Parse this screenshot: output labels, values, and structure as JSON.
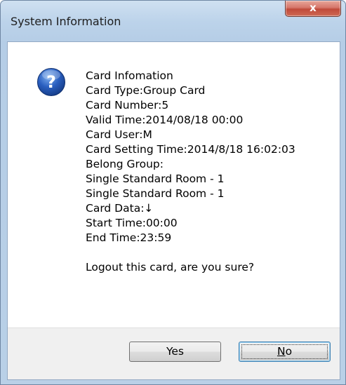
{
  "window": {
    "title": "System Information",
    "close_label": "x"
  },
  "icon": "question-icon",
  "message": {
    "lines": [
      "Card Infomation",
      "Card Type:Group Card",
      "Card Number:5",
      "Valid Time:2014/08/18 00:00",
      "Card User:M",
      "Card Setting Time:2014/8/18 16:02:03",
      "Belong Group:",
      "Single Standard Room - 1",
      "Single Standard Room - 1",
      "Card Data:↓",
      "Start Time:00:00",
      "End Time:23:59"
    ],
    "question": "Logout this card, are you sure?"
  },
  "buttons": {
    "yes_label": "Yes",
    "no_mnemonic": "N",
    "no_rest": "o"
  },
  "colors": {
    "frame": "#b9d0e7",
    "close_button": "#c04a3a",
    "default_button_border": "#3c7fb1",
    "icon_blue": "#1f4fa8"
  }
}
